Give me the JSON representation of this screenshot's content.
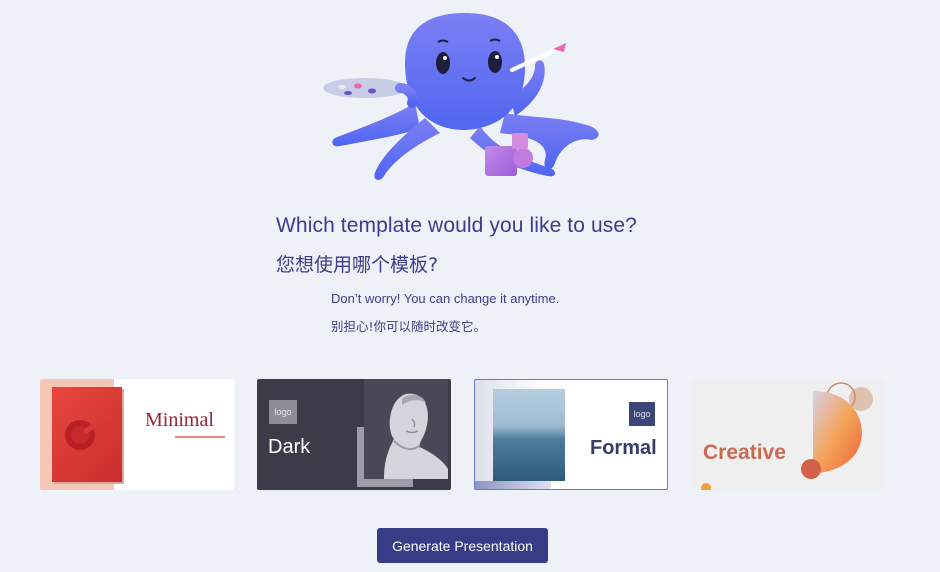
{
  "prompt": {
    "question_en": "Which template would you like to use?",
    "question_zh": "您想使用哪个模板?",
    "hint_en": "Don’t worry! You can change it anytime.",
    "hint_zh": "别担心!你可以随时改变它。"
  },
  "templates": [
    {
      "title": "Minimal",
      "logo": ""
    },
    {
      "title": "Dark",
      "logo": "logo"
    },
    {
      "title": "Formal",
      "logo": "logo"
    },
    {
      "title": "Creative",
      "logo": ""
    }
  ],
  "actions": {
    "generate_label": "Generate Presentation"
  },
  "colors": {
    "background": "#eef1f8",
    "accent": "#363d86",
    "heading_text": "#3b3d8c",
    "mascot": "#6b6ef0"
  },
  "icons": [
    "octopus-mascot-illustration",
    "paint-palette-icon",
    "paintbrush-icon"
  ]
}
